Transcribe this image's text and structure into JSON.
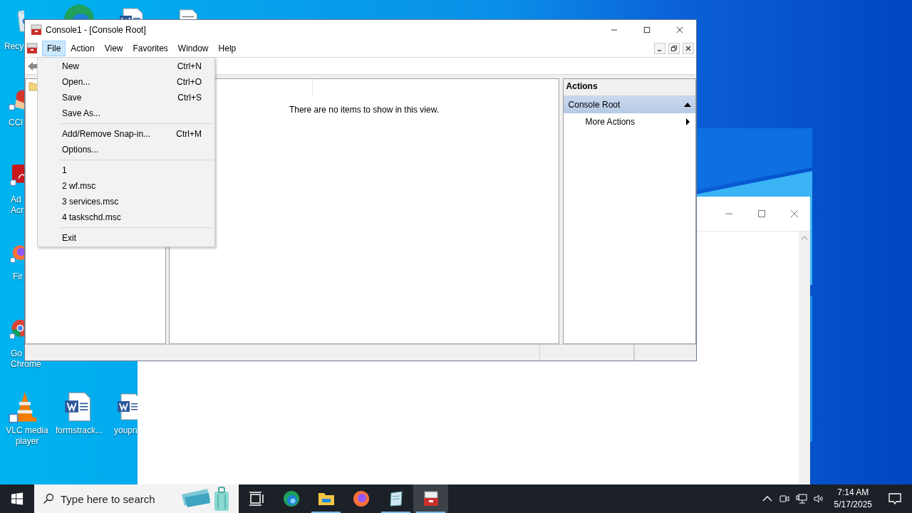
{
  "desktop": {
    "icons": [
      {
        "kind": "recycle-bin",
        "lines": [
          "Recy"
        ]
      },
      {
        "kind": "edge"
      },
      {
        "kind": "word-document"
      },
      {
        "kind": "text-document"
      },
      {
        "kind": "ccleaner",
        "lines": [
          "CCl"
        ]
      },
      {
        "kind": "acrobat",
        "lines": [
          "Ad",
          "Acr"
        ]
      },
      {
        "kind": "firefox",
        "lines": [
          "Fir"
        ]
      },
      {
        "kind": "chrome",
        "lines": [
          "Go",
          "Chrome"
        ]
      },
      {
        "kind": "vlc",
        "lines": [
          "VLC media",
          "player"
        ]
      },
      {
        "kind": "word-document",
        "lines": [
          "formstrack..."
        ]
      },
      {
        "kind": "word-document",
        "lines": [
          "youpn"
        ]
      }
    ]
  },
  "background_window": {
    "kind": "blank"
  },
  "window": {
    "title": "Console1 - [Console Root]",
    "menu_bar": [
      {
        "label": "File",
        "selected": true
      },
      {
        "label": "Action",
        "selected": false
      },
      {
        "label": "View",
        "selected": false
      },
      {
        "label": "Favorites",
        "selected": false
      },
      {
        "label": "Window",
        "selected": false
      },
      {
        "label": "Help",
        "selected": false
      }
    ],
    "results": {
      "empty_message": "There are no items to show in this view."
    },
    "actions": {
      "title": "Actions",
      "rows": [
        {
          "kind": "group",
          "label": "Console Root",
          "selected": true,
          "expanded": true
        },
        {
          "kind": "submenu",
          "label": "More Actions",
          "selected": false
        }
      ]
    }
  },
  "file_menu": [
    {
      "kind": "item",
      "label": "New",
      "shortcut": "Ctrl+N"
    },
    {
      "kind": "item",
      "label": "Open...",
      "shortcut": "Ctrl+O"
    },
    {
      "kind": "item",
      "label": "Save",
      "shortcut": "Ctrl+S"
    },
    {
      "kind": "item",
      "label": "Save As..."
    },
    {
      "kind": "separator"
    },
    {
      "kind": "item",
      "label": "Add/Remove Snap-in...",
      "shortcut": "Ctrl+M"
    },
    {
      "kind": "item",
      "label": "Options..."
    },
    {
      "kind": "separator"
    },
    {
      "kind": "item",
      "label": "1"
    },
    {
      "kind": "item",
      "label": "2 wf.msc"
    },
    {
      "kind": "item",
      "label": "3 services.msc"
    },
    {
      "kind": "item",
      "label": "4 taskschd.msc"
    },
    {
      "kind": "separator"
    },
    {
      "kind": "item",
      "label": "Exit"
    }
  ],
  "taskbar": {
    "search": {
      "placeholder": "Type here to search"
    },
    "apps": [
      {
        "kind": "task-view",
        "running": false,
        "active": false
      },
      {
        "kind": "edge",
        "running": false,
        "active": false
      },
      {
        "kind": "explorer",
        "running": true,
        "active": false
      },
      {
        "kind": "firefox",
        "running": false,
        "active": false
      },
      {
        "kind": "notepad",
        "running": true,
        "active": false
      },
      {
        "kind": "console",
        "running": true,
        "active": true
      }
    ],
    "time": "7:14 AM",
    "date": "5/17/2025"
  }
}
